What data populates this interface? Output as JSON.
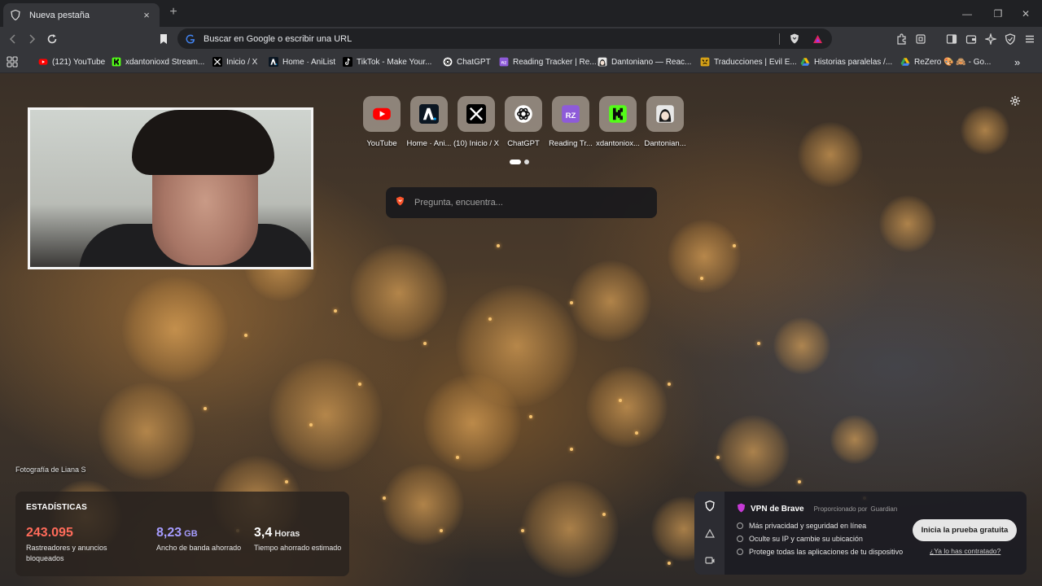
{
  "tab": {
    "title": "Nueva pestaña",
    "close": "×",
    "new_tab": "+"
  },
  "window_controls": {
    "minimize": "—",
    "restore": "❐",
    "close": "✕"
  },
  "omnibox": {
    "text": "Buscar en Google o escribir una URL"
  },
  "bookmarks": [
    {
      "label": "(121) YouTube",
      "icon": "youtube-icon",
      "color": "#ff0000"
    },
    {
      "label": "xdantonioxd Stream...",
      "icon": "kick-icon",
      "color": "#53fc18"
    },
    {
      "label": "Inicio / X",
      "icon": "x-icon",
      "color": "#000000"
    },
    {
      "label": "Home · AniList",
      "icon": "anilist-icon",
      "color": "#0b1622"
    },
    {
      "label": "TikTok - Make Your...",
      "icon": "tiktok-icon",
      "color": "#000000"
    },
    {
      "label": "ChatGPT",
      "icon": "chatgpt-icon",
      "color": "#ffffff"
    },
    {
      "label": "Reading Tracker | Re...",
      "icon": "reading-tracker-icon",
      "color": "#8e5bd9"
    },
    {
      "label": "Dantoniano — Reac...",
      "icon": "dantoniano-icon",
      "color": "#555555"
    },
    {
      "label": "Traducciones | Evil E...",
      "icon": "evil-icon",
      "color": "#d4a017"
    },
    {
      "label": "Historias paralelas /...",
      "icon": "drive-icon",
      "color": "#34a853"
    },
    {
      "label": "ReZero 🎨 🙈 - Go...",
      "icon": "rezero-icon",
      "color": "#4285f4"
    }
  ],
  "bookmarks_more": "»",
  "top_sites": [
    {
      "label": "YouTube",
      "icon": "youtube-icon"
    },
    {
      "label": "Home · Ani...",
      "icon": "anilist-icon"
    },
    {
      "label": "(10) Inicio / X",
      "icon": "x-icon"
    },
    {
      "label": "ChatGPT",
      "icon": "chatgpt-icon"
    },
    {
      "label": "Reading Tr...",
      "icon": "reading-tracker-icon"
    },
    {
      "label": "xdantoniox...",
      "icon": "kick-icon"
    },
    {
      "label": "Dantonian...",
      "icon": "dantoniano-icon"
    }
  ],
  "search": {
    "placeholder": "Pregunta, encuentra..."
  },
  "photo_credit": "Fotografía de Liana S",
  "stats": {
    "header": "ESTADÍSTICAS",
    "trackers": {
      "value": "243.095",
      "desc": "Rastreadores y anuncios bloqueados",
      "color": "#ff6b5a"
    },
    "bandwidth": {
      "value": "8,23",
      "unit": "GB",
      "desc": "Ancho de banda ahorrado",
      "color": "#a69cff"
    },
    "time": {
      "value": "3,4",
      "unit": "Horas",
      "desc": "Tiempo ahorrado estimado",
      "color": "#ffffff"
    }
  },
  "vpn": {
    "title": "VPN de Brave",
    "provider": "Proporcionado por",
    "provider_name": "Guardian",
    "features": [
      "Más privacidad y seguridad en línea",
      "Oculte su IP y cambie su ubicación",
      "Protege todas las aplicaciones de tu dispositivo"
    ],
    "cta": "Inicia la prueba gratuita",
    "link": "¿Ya lo has contratado?"
  }
}
